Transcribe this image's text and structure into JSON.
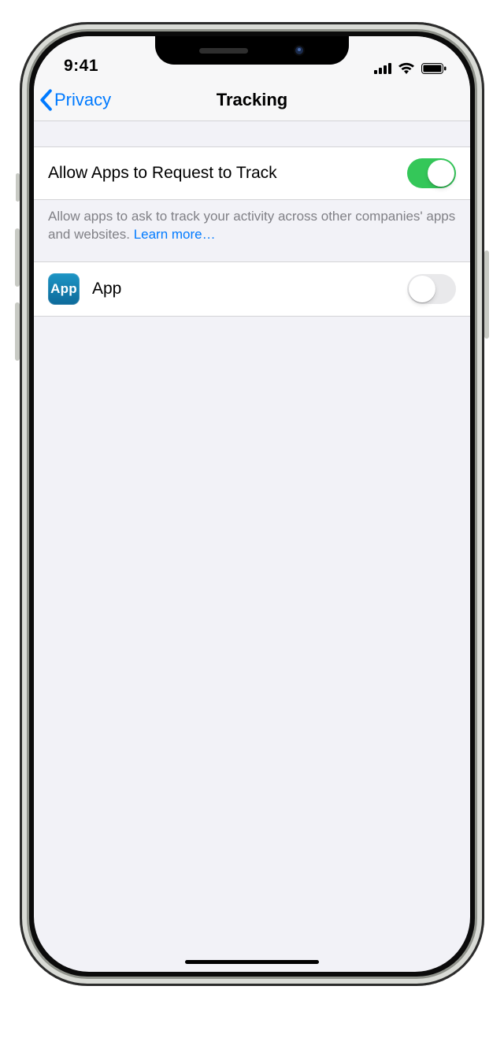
{
  "status": {
    "time": "9:41"
  },
  "nav": {
    "back_label": "Privacy",
    "title": "Tracking"
  },
  "main_toggle": {
    "label": "Allow Apps to Request to Track",
    "on": true
  },
  "footer": {
    "text": "Allow apps to ask to track your activity across other companies' apps and websites. ",
    "learn_more": "Learn more…"
  },
  "apps": [
    {
      "icon_text": "App",
      "name": "App",
      "on": false
    }
  ]
}
